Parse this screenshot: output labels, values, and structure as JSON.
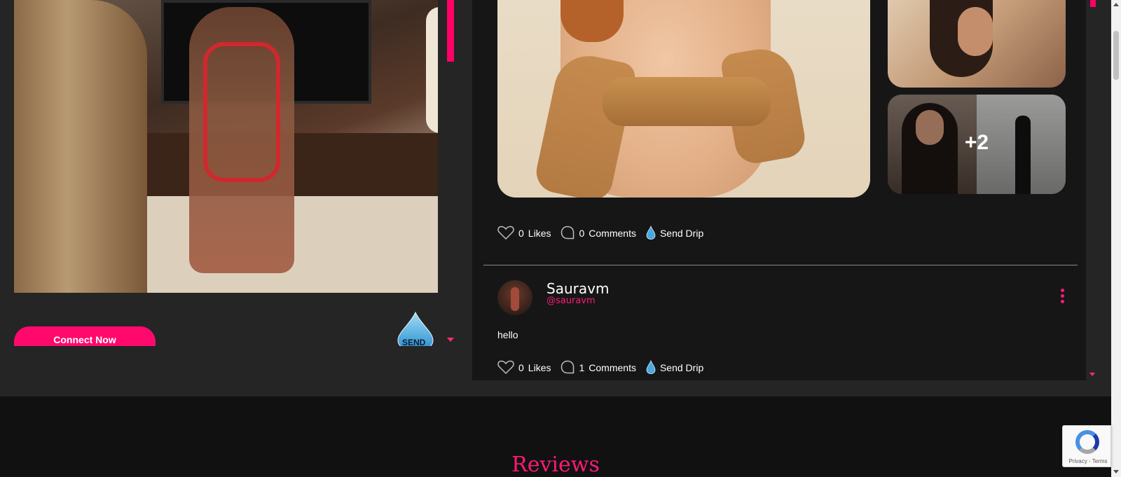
{
  "left_panel": {
    "connect_button": "Connect Now",
    "send_label": "SEND"
  },
  "feed": {
    "media_post": {
      "more_count": "+2",
      "likes_count": "0",
      "likes_label": "Likes",
      "comments_count": "0",
      "comments_label": "Comments",
      "send_drip_label": "Send Drip"
    },
    "text_post": {
      "author_name": "Sauravm",
      "author_handle": "@sauravm",
      "text": "hello",
      "likes_count": "0",
      "likes_label": "Likes",
      "comments_count": "1",
      "comments_label": "Comments",
      "send_drip_label": "Send Drip"
    }
  },
  "reviews": {
    "title": "Reviews"
  },
  "recaptcha": {
    "links": "Privacy - Terms"
  },
  "colors": {
    "accent": "#ff1a75",
    "panel_bg": "#252525",
    "feed_bg": "#161616",
    "page_bg": "#111111"
  },
  "icons": [
    "heart-icon",
    "comment-icon",
    "drop-icon",
    "kebab-menu-icon",
    "caret-down-icon",
    "send-drop-icon",
    "recaptcha-icon"
  ]
}
